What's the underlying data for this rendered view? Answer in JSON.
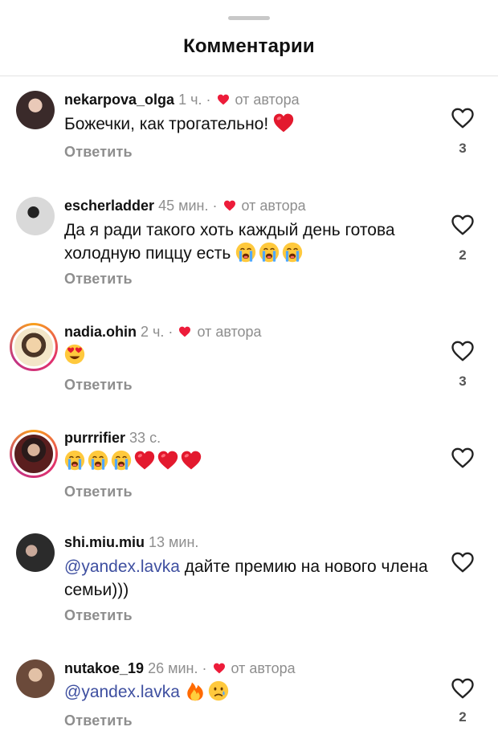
{
  "header": {
    "title": "Комментарии"
  },
  "author_like_label": "от автора",
  "reply_label": "Ответить",
  "comments": [
    {
      "username": "nekarpova_olga",
      "time": "1 ч.",
      "author_liked": true,
      "text": "Божечки, как трогательно!",
      "emojis": [
        "red-heart"
      ],
      "likes": "3",
      "avatar_color": "#3a2a2a",
      "story_ring": false
    },
    {
      "username": "escherladder",
      "time": "45 мин.",
      "author_liked": true,
      "text": "Да я ради такого хоть каждый день готова холодную пиццу есть",
      "emojis": [
        "loudly-crying",
        "loudly-crying",
        "loudly-crying"
      ],
      "likes": "2",
      "avatar_color": "#d9d9d9",
      "story_ring": false
    },
    {
      "username": "nadia.ohin",
      "time": "2 ч.",
      "author_liked": true,
      "text": "",
      "emojis": [
        "heart-eyes"
      ],
      "likes": "3",
      "avatar_color": "#f3e6c8",
      "story_ring": true
    },
    {
      "username": "purrrifier",
      "time": "33 с.",
      "author_liked": false,
      "text": "",
      "emojis": [
        "loudly-crying",
        "loudly-crying",
        "loudly-crying",
        "red-heart",
        "red-heart",
        "red-heart"
      ],
      "likes": "",
      "avatar_color": "#5a1e1e",
      "story_ring": true
    },
    {
      "username": "shi.miu.miu",
      "time": "13 мин.",
      "author_liked": false,
      "mention": "@yandex.lavka",
      "text": "дайте премию на нового члена семьи)))",
      "emojis": [],
      "likes": "",
      "avatar_color": "#2b2b2b",
      "story_ring": false
    },
    {
      "username": "nutakoe_19",
      "time": "26 мин.",
      "author_liked": true,
      "mention": "@yandex.lavka",
      "text": "",
      "emojis": [
        "fire",
        "crying"
      ],
      "likes": "2",
      "avatar_color": "#6b4a3a",
      "story_ring": false
    }
  ],
  "colors": {
    "heart_red": "#ed1c3a",
    "mention_blue": "#3e4fa0",
    "secondary_gray": "#8e8e8e"
  }
}
